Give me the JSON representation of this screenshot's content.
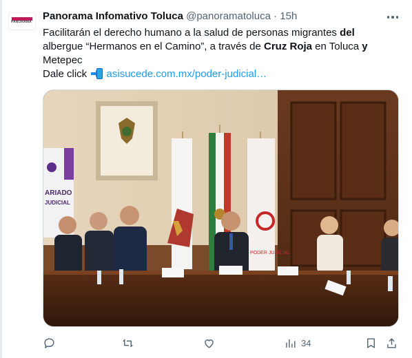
{
  "tweet": {
    "author_name": "Panorama Infomativo Toluca",
    "author_handle": "@panoramatoluca",
    "separator": "·",
    "time": "15h",
    "text": {
      "p1": "Facilitarán el derecho humano a la salud de personas migrantes ",
      "b1": "del",
      "p2": "albergue “Hermanos en el Camino”, a través de ",
      "b2": "Cruz Roja",
      "p3": " en Toluca ",
      "b3": "y",
      "p4": "Metepec",
      "p5": "Dale click ",
      "link": "asisucede.com.mx/poder-judicial…"
    },
    "avatar_text": "PANORAMA",
    "media": {
      "banner_lines": [
        "ARIADO",
        "JUDICIAL"
      ],
      "flag_label": "PODER JUDICIAL"
    }
  },
  "actions": {
    "reply_count": "",
    "retweet_count": "",
    "like_count": "",
    "views_count": "34"
  },
  "colors": {
    "link": "#1d9bf0",
    "muted": "#536471",
    "text": "#0f1419"
  },
  "icons": [
    "more-icon",
    "reply-icon",
    "retweet-icon",
    "like-icon",
    "views-icon",
    "bookmark-icon",
    "share-icon"
  ]
}
